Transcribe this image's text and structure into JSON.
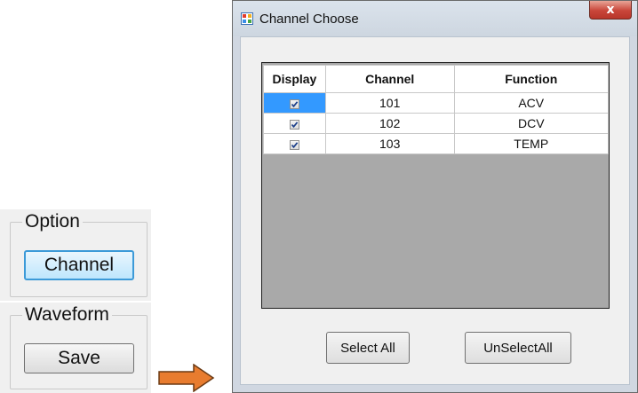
{
  "option_panel": {
    "title": "Option",
    "button_label": "Channel"
  },
  "waveform_panel": {
    "title": "Waveform",
    "button_label": "Save"
  },
  "arrow_color": "#e87c2f",
  "dialog": {
    "title": "Channel Choose",
    "close_label": "x",
    "table": {
      "columns": [
        "Display",
        "Channel",
        "Function"
      ],
      "rows": [
        {
          "display": true,
          "channel": "101",
          "function": "ACV",
          "selected": true
        },
        {
          "display": true,
          "channel": "102",
          "function": "DCV",
          "selected": false
        },
        {
          "display": true,
          "channel": "103",
          "function": "TEMP",
          "selected": false
        }
      ]
    },
    "buttons": {
      "select_all": "Select All",
      "unselect_all": "UnSelectAll"
    }
  }
}
